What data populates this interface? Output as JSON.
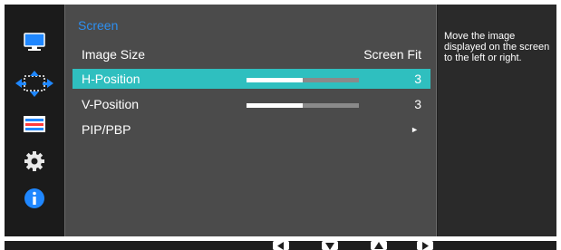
{
  "sidebar": {
    "items": [
      {
        "icon": "monitor-icon"
      },
      {
        "icon": "move-arrows-icon"
      },
      {
        "icon": "color-icon"
      },
      {
        "icon": "gear-icon"
      },
      {
        "icon": "info-icon"
      }
    ],
    "accent": "#1f87ff"
  },
  "menu": {
    "title": "Screen",
    "accent": "#2d8ff0",
    "highlight": "#2fbfbf",
    "items": [
      {
        "label": "Image Size",
        "value": "Screen Fit"
      },
      {
        "label": "H-Position",
        "value": "3",
        "level": 0.5
      },
      {
        "label": "V-Position",
        "value": "3",
        "level": 0.5
      },
      {
        "label": "PIP/PBP",
        "value": "►"
      }
    ]
  },
  "help": {
    "text": "Move the image displayed on the screen to the left or right."
  },
  "nav": {
    "buttons": [
      {
        "icon": "arrow-left-icon"
      },
      {
        "icon": "arrow-down-icon"
      },
      {
        "icon": "arrow-up-icon"
      },
      {
        "icon": "arrow-right-icon"
      }
    ]
  }
}
